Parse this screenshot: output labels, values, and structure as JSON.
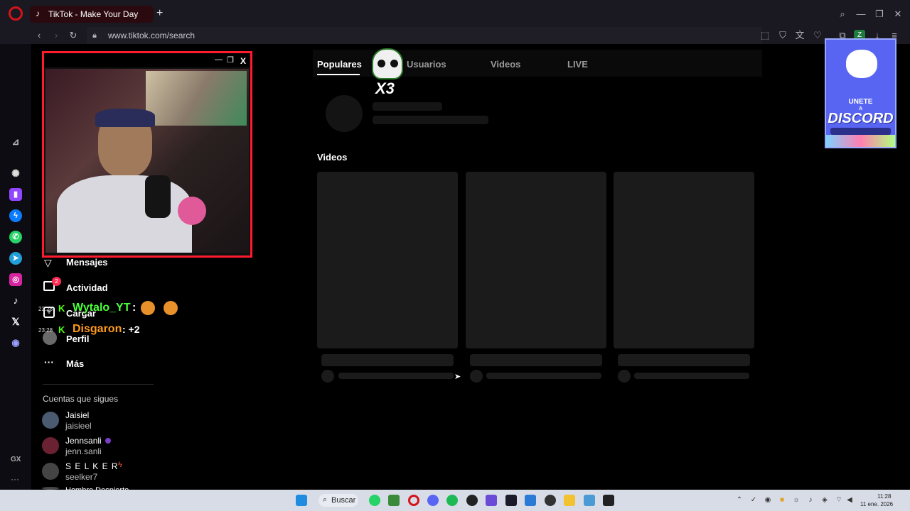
{
  "browser": {
    "tab_title": "TikTok - Make Your Day",
    "tab_add": "+",
    "url": "www.tiktok.com/search",
    "profile_badge": "Z"
  },
  "tiktok": {
    "tabs": [
      "Populares",
      "Usuarios",
      "Videos",
      "LIVE"
    ],
    "videos_heading": "Videos",
    "nav": {
      "mensajes": "Mensajes",
      "actividad": "Actividad",
      "actividad_badge": "2",
      "cargar": "Cargar",
      "perfil": "Perfil",
      "mas": "Más"
    },
    "following_heading": "Cuentas que sigues",
    "following": [
      {
        "name": "Jaisiel",
        "user": "jaisieel"
      },
      {
        "name": "Jennsanli",
        "user": "jenn.sanli"
      },
      {
        "name": "S E L K E R",
        "user": "seelker7"
      },
      {
        "name": "Hombre Despierto",
        "user": ""
      }
    ]
  },
  "overlay": {
    "webcam_close": "X",
    "logo_text": "X3",
    "chat": [
      {
        "time": "23:28",
        "user": "Wytalo_YT",
        "user_color": "#4cff3a",
        "message": ":"
      },
      {
        "time": "23:28",
        "user": "Disgaron",
        "user_color": "#ff9a1f",
        "message": ": +2"
      }
    ],
    "discord_banner": {
      "line1": "UNETE",
      "line2": "A",
      "line3": "DISCORD"
    }
  },
  "opera_sidebar": {
    "gx_label": "GX",
    "more_label": "···"
  },
  "taskbar": {
    "search_label": "Buscar",
    "clock_time": "11:28",
    "clock_date": "11 ene. 2026"
  },
  "colors": {
    "opera_red": "#d4141a",
    "tiktok_accent": "#fe2c55",
    "webcam_border": "#ff1a2e",
    "discord_blue": "#5865f2"
  }
}
